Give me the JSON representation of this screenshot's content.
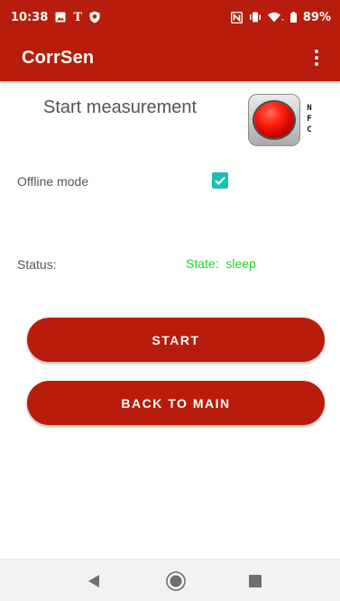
{
  "status_bar": {
    "time": "10:38",
    "carrier_glyph": "T",
    "battery_percent": "89%",
    "icons": [
      "image-icon",
      "carrier-t-icon",
      "shield-icon",
      "nfc-icon",
      "vibrate-icon",
      "wifi-icon",
      "battery-icon"
    ]
  },
  "app_bar": {
    "title": "CorrSen",
    "menu_icon": "overflow-menu-icon"
  },
  "main": {
    "heading": "Start measurement",
    "nfc_button": {
      "icon": "red-record-button-icon",
      "letters": [
        "N",
        "F",
        "C"
      ]
    },
    "offline_mode": {
      "label": "Offline mode",
      "checked": true
    },
    "status": {
      "label": "Status:",
      "value": "State:  sleep"
    },
    "buttons": {
      "start": "START",
      "back_to_main": "BACK TO MAIN"
    }
  },
  "nav_bar": {
    "icons": [
      "back-triangle-icon",
      "home-circle-icon",
      "recents-square-icon"
    ]
  },
  "colors": {
    "primary": "#b71c0c",
    "accent": "#1bbfb3",
    "status_green": "#1ed62a",
    "label_gray": "#555555"
  }
}
